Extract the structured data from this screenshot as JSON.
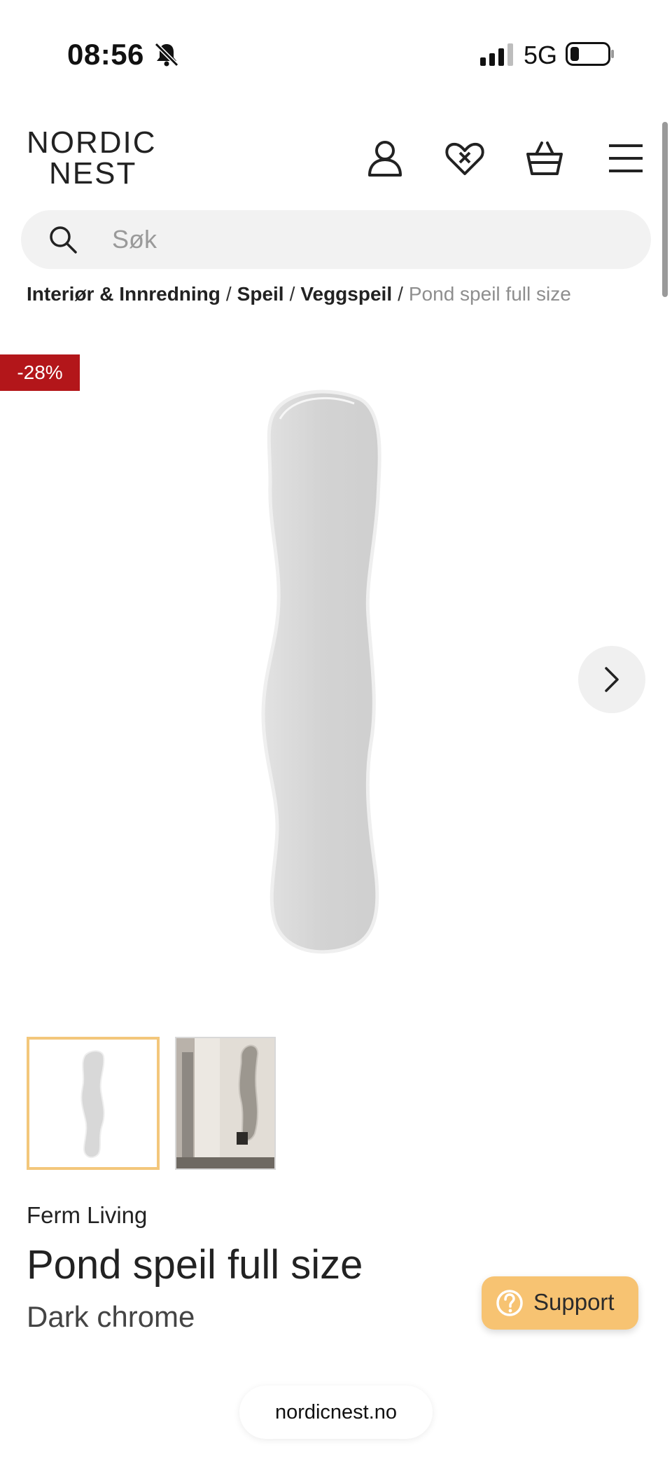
{
  "status_bar": {
    "time": "08:56",
    "network": "5G",
    "icons": [
      "bell-muted-icon",
      "signal-icon",
      "battery-icon"
    ]
  },
  "header": {
    "logo_line1": "NORDIC",
    "logo_line2": "NEST",
    "icons": [
      "account-icon",
      "wishlist-heart-icon",
      "cart-basket-icon",
      "menu-icon"
    ]
  },
  "search": {
    "placeholder": "Søk",
    "value": ""
  },
  "breadcrumb": {
    "items": [
      "Interiør & Innredning",
      "Speil",
      "Veggspeil"
    ],
    "separator": "/",
    "current": "Pond speil full size"
  },
  "product": {
    "discount_badge": "-28%",
    "brand": "Ferm Living",
    "name": "Pond speil full size",
    "variant": "Dark chrome",
    "thumbnails": [
      "mirror-front-thumbnail",
      "mirror-room-thumbnail"
    ],
    "selected_thumbnail": 0
  },
  "support": {
    "label": "Support"
  },
  "url": {
    "domain": "nordicnest.no"
  },
  "colors": {
    "discount_red": "#b3161a",
    "support_orange": "#f7c372",
    "thumb_border": "#f3c77b"
  }
}
